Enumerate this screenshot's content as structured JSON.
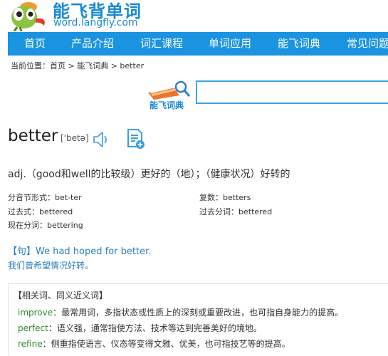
{
  "header": {
    "brand_title": "能飞背单词",
    "brand_url": "word.langfly.com"
  },
  "nav": {
    "items": [
      {
        "label": "首页"
      },
      {
        "label": "产品介绍"
      },
      {
        "label": "词汇课程"
      },
      {
        "label": "单词应用"
      },
      {
        "label": "能飞词典"
      },
      {
        "label": "常见问题"
      }
    ]
  },
  "breadcrumb": "当前位置：首页 > 能飞词典 > better",
  "dict_logo": {
    "label": "能飞词典"
  },
  "search": {
    "value": "",
    "placeholder": ""
  },
  "entry": {
    "word": "better",
    "phonetic": "['betə]",
    "definition": "adj.（good和well的比较级）更好的（地）；（健康状况）好转的",
    "forms": {
      "syllables": "分音节形式：bet-ter",
      "plural": "复数：betters",
      "past": "过去式：bettered",
      "past_participle": "过去分词：bettered",
      "present_participle": "现在分词：bettering"
    },
    "example": {
      "en": "【句】We had hoped for better.",
      "zh": "我们曾希望情况好转。"
    }
  },
  "synonyms": {
    "title": "【相关词、同义近义词】",
    "items": [
      {
        "word": "improve",
        "desc": "：最常用词，多指状态或性质上的深刻或重要改进，也可指自身能力的提高。"
      },
      {
        "word": "perfect",
        "desc": "：语义强，通常指使方法、技术等达到完善美好的境地。"
      },
      {
        "word": "refine",
        "desc": "：侧重指使语言、仪态等变得文雅、优美，也可指技艺等的提高。"
      }
    ]
  },
  "colors": {
    "accent": "#1a93e0",
    "brand": "#1a8ad4",
    "example_text": "#2a7fc0",
    "synonym_word": "#2e8b2e"
  },
  "icons": [
    "parrot-logo-icon",
    "dictionary-book-icon",
    "speaker-icon",
    "add-to-wordbook-icon"
  ]
}
